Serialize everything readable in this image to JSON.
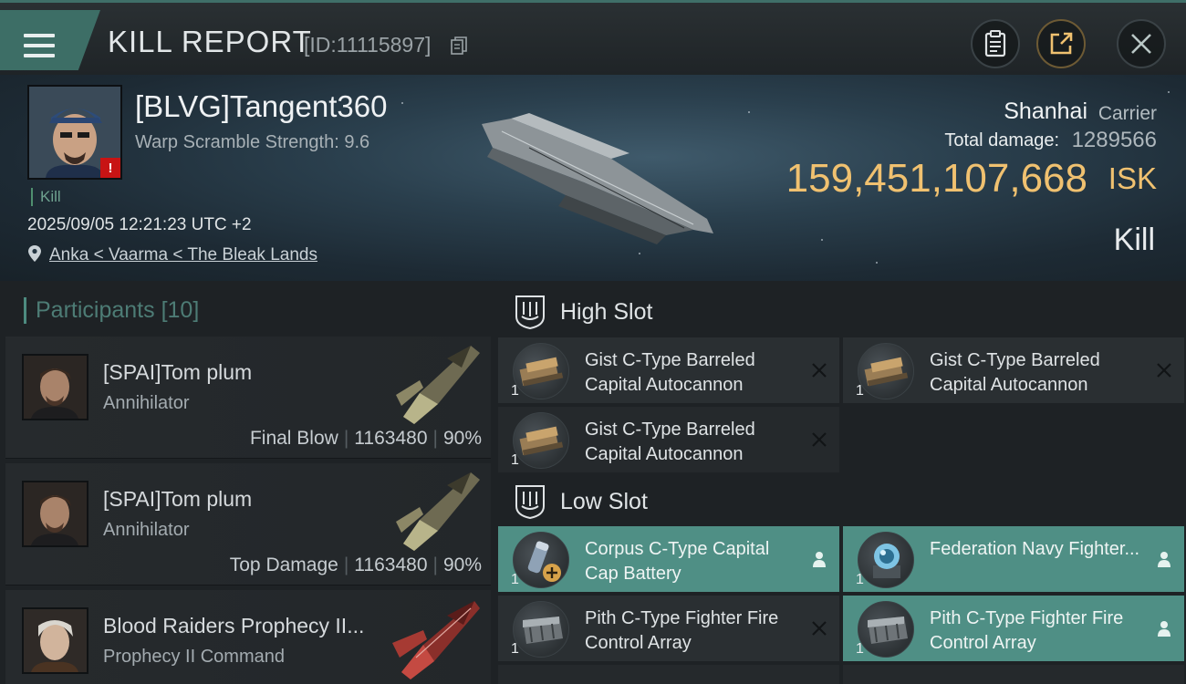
{
  "header": {
    "title": "KILL REPORT",
    "report_id": "[ID:11115897]"
  },
  "victim": {
    "name": "[BLVG]Tangent360",
    "warp_scramble": "Warp Scramble Strength: 9.6",
    "kill_tag": "Kill",
    "datetime": "2025/09/05 12:21:23 UTC +2",
    "location": "Anka < Vaarma < The Bleak Lands",
    "ship_name": "Shanhai",
    "ship_class": "Carrier",
    "total_damage_label": "Total damage:",
    "total_damage_value": "1289566",
    "isk_value": "159,451,107,668",
    "isk_unit": "ISK",
    "result": "Kill"
  },
  "participants": {
    "header": "Participants",
    "count": "[10]",
    "rows": [
      {
        "name": "[SPAI]Tom plum",
        "ship": "Annihilator",
        "role": "Final Blow",
        "damage": "1163480",
        "percent": "90%"
      },
      {
        "name": "[SPAI]Tom plum",
        "ship": "Annihilator",
        "role": "Top Damage",
        "damage": "1163480",
        "percent": "90%"
      },
      {
        "name": "Blood Raiders Prophecy II...",
        "ship": "Prophecy II Command"
      }
    ]
  },
  "fitting": {
    "high_slot": {
      "title": "High Slot",
      "modules": [
        {
          "qty": "1",
          "name": "Gist C-Type Barreled Capital Autocannon"
        },
        {
          "qty": "1",
          "name": "Gist C-Type Barreled Capital Autocannon"
        },
        {
          "qty": "1",
          "name": "Gist C-Type Barreled Capital Autocannon"
        }
      ]
    },
    "low_slot": {
      "title": "Low Slot",
      "modules": [
        {
          "qty": "1",
          "name": "Corpus C-Type Capital Cap Battery"
        },
        {
          "qty": "1",
          "name": "Federation Navy Fighter..."
        },
        {
          "qty": "1",
          "name": "Pith C-Type Fighter Fire Control Array"
        },
        {
          "qty": "1",
          "name": "Pith C-Type Fighter Fire Control Array"
        }
      ]
    }
  },
  "colors": {
    "accent": "#4f8f85",
    "isk": "#f0c170",
    "warning": "#c81414"
  }
}
